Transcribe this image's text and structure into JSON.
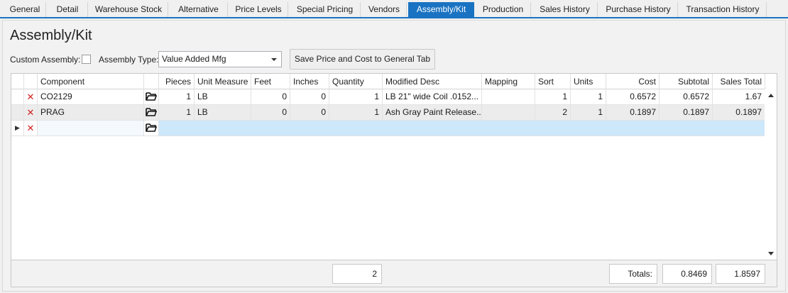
{
  "tabs": [
    {
      "label": "General"
    },
    {
      "label": "Detail"
    },
    {
      "label": "Warehouse Stock"
    },
    {
      "label": "Alternative"
    },
    {
      "label": "Price Levels"
    },
    {
      "label": "Special Pricing"
    },
    {
      "label": "Vendors"
    },
    {
      "label": "Assembly/Kit",
      "active": true
    },
    {
      "label": "Production"
    },
    {
      "label": "Sales History"
    },
    {
      "label": "Purchase History"
    },
    {
      "label": "Transaction History"
    }
  ],
  "page": {
    "title": "Assembly/Kit",
    "custom_assembly_label": "Custom Assembly:",
    "assembly_type_label": "Assembly Type:",
    "assembly_type_value": "Value Added Mfg",
    "save_button_label": "Save Price and Cost to General Tab"
  },
  "grid": {
    "columns": [
      "Component",
      "Pieces",
      "Unit Measure",
      "Feet",
      "Inches",
      "Quantity",
      "Modified Desc",
      "Mapping",
      "Sort",
      "Units",
      "Cost",
      "Subtotal",
      "Sales Total"
    ],
    "rows": [
      {
        "component": "CO2129",
        "pieces": "1",
        "unit_measure": "LB",
        "feet": "0",
        "inches": "0",
        "quantity": "1",
        "modified_desc": "LB 21\" wide Coil .0152...",
        "mapping": "",
        "sort": "1",
        "units": "1",
        "cost": "0.6572",
        "subtotal": "0.6572",
        "sales_total": "1.67"
      },
      {
        "component": "PRAG",
        "pieces": "1",
        "unit_measure": "LB",
        "feet": "0",
        "inches": "0",
        "quantity": "1",
        "modified_desc": "Ash Gray Paint Release...",
        "mapping": "",
        "sort": "2",
        "units": "1",
        "cost": "0.1897",
        "subtotal": "0.1897",
        "sales_total": "0.1897"
      }
    ]
  },
  "totals": {
    "quantity_total": "2",
    "label": "Totals:",
    "subtotal": "0.8469",
    "sales_total": "1.8597"
  },
  "icons": {
    "delete": "x-icon",
    "browse": "folder-open-icon",
    "row_pointer": "row-pointer-icon"
  },
  "colors": {
    "accent": "#1a73c2",
    "delete": "#d02020",
    "new_row": "#cde7fb"
  }
}
